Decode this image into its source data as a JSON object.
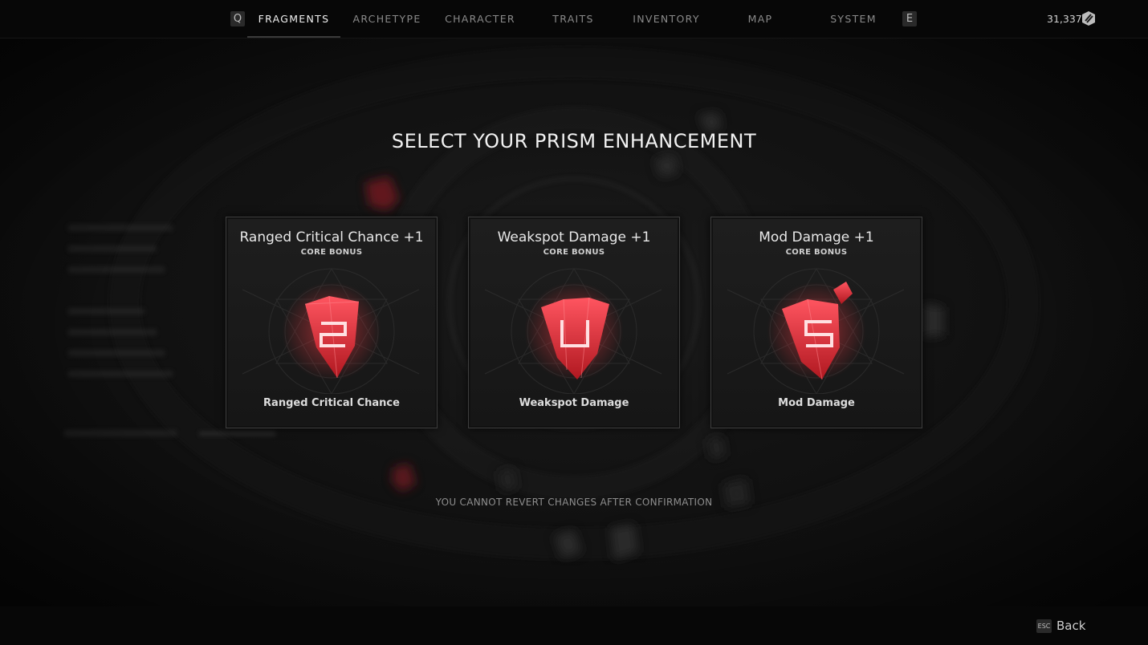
{
  "nav": {
    "prev_key": "Q",
    "next_key": "E",
    "tabs": [
      {
        "label": "FRAGMENTS",
        "active": true
      },
      {
        "label": "ARCHETYPE",
        "active": false
      },
      {
        "label": "CHARACTER",
        "active": false
      },
      {
        "label": "TRAITS",
        "active": false
      },
      {
        "label": "INVENTORY",
        "active": false
      },
      {
        "label": "MAP",
        "active": false
      },
      {
        "label": "SYSTEM",
        "active": false
      }
    ],
    "currency": "31,337",
    "currency_icon": "scrap-currency-icon"
  },
  "heading": "SELECT YOUR PRISM ENHANCEMENT",
  "cards": [
    {
      "title": "Ranged Critical Chance +1",
      "subtitle": "CORE BONUS",
      "name": "Ranged Critical Chance",
      "icon": "red-prism-crystal-icon"
    },
    {
      "title": "Weakspot Damage +1",
      "subtitle": "CORE BONUS",
      "name": "Weakspot Damage",
      "icon": "red-prism-crystal-icon"
    },
    {
      "title": "Mod Damage +1",
      "subtitle": "CORE BONUS",
      "name": "Mod Damage",
      "icon": "red-prism-crystal-icon"
    }
  ],
  "warning": "YOU CANNOT REVERT CHANGES AFTER CONFIRMATION",
  "footer": {
    "esc_key": "ESC",
    "back_label": "Back"
  },
  "colors": {
    "accent_red": "#e8323c",
    "background": "#121212",
    "card_border": "#3e3e3e"
  }
}
